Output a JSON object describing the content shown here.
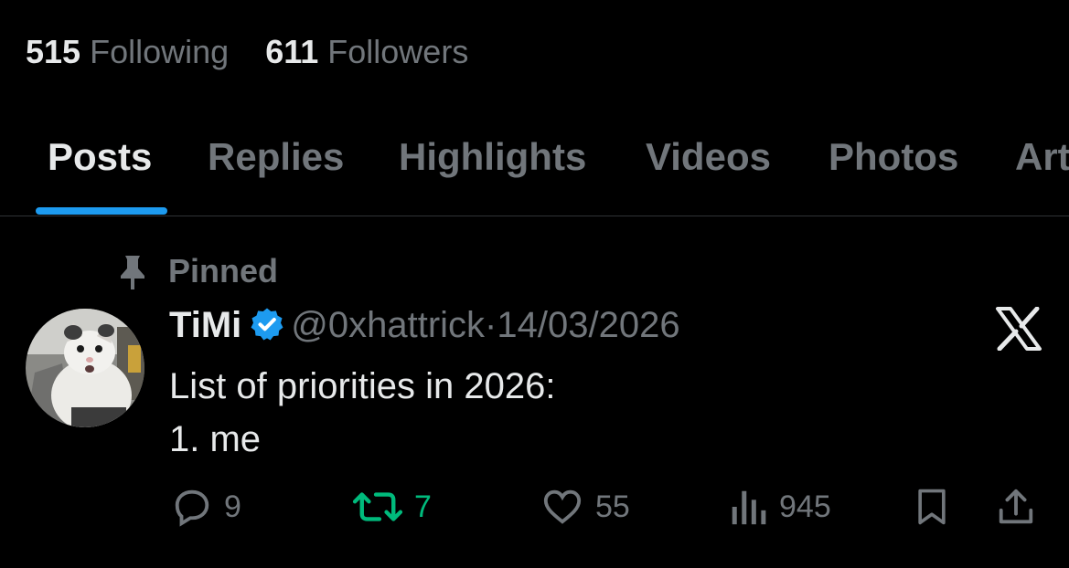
{
  "stats": {
    "following_count": "515",
    "following_label": "Following",
    "followers_count": "611",
    "followers_label": "Followers"
  },
  "tabs": [
    {
      "label": "Posts",
      "active": true
    },
    {
      "label": "Replies"
    },
    {
      "label": "Highlights"
    },
    {
      "label": "Videos"
    },
    {
      "label": "Photos"
    },
    {
      "label": "Art"
    }
  ],
  "post": {
    "pinned_label": "Pinned",
    "author_name": "TiMi",
    "handle": "@0xhattrick",
    "separator": "·",
    "date": "14/03/2026",
    "text_line1": "List of priorities in 2026:",
    "text_line2": "1. me",
    "replies": "9",
    "reposts": "7",
    "likes": "55",
    "views": "945"
  },
  "colors": {
    "background": "#000000",
    "text": "#e7e9ea",
    "muted": "#71767b",
    "accent": "#1d9bf0",
    "repost": "#00ba7c"
  },
  "icons": [
    "pin-icon",
    "verified-badge-icon",
    "x-logo-icon",
    "reply-icon",
    "repost-icon",
    "like-icon",
    "views-icon",
    "bookmark-icon",
    "share-icon"
  ]
}
